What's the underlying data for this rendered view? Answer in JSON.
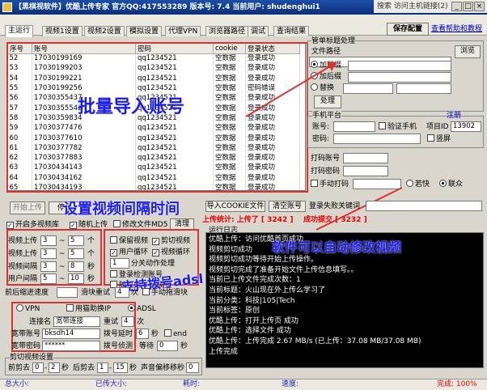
{
  "window": {
    "title": "【黑棋视软件】优酷上传专家 官方QQ:417553289 版本号: 7.4 当前用户: shudenghui1",
    "top_right_text": "搜索 访问主机链接(2)",
    "min": "_",
    "max": "□",
    "close": "×"
  },
  "tabs": [
    "主运行",
    "视频1设置",
    "视频2设置",
    "模拟设置",
    "代理VPN",
    "浏览器路径",
    "调试",
    "查询结果"
  ],
  "toolbar": {
    "save_config": "保存配置",
    "help_link": "查看帮助和教程"
  },
  "grid": {
    "columns": [
      "序号",
      "账号",
      "密码",
      "cookie",
      "登录状态"
    ],
    "rows": [
      [
        "52",
        "17030199169",
        "qq1234521",
        "空数据",
        "登录成功"
      ],
      [
        "53",
        "17030199203",
        "qq1234521",
        "空数据",
        "登录成功"
      ],
      [
        "54",
        "17030199221",
        "qq1234521",
        "空数据",
        "登录成功"
      ],
      [
        "55",
        "17030199256",
        "qq1234521",
        "空数据",
        "密码错误"
      ],
      [
        "56",
        "17030355437",
        "qq1234521",
        "空数据",
        "登录成功"
      ],
      [
        "57",
        "17030355542",
        "qq1234521",
        "空数据",
        "登录成功"
      ],
      [
        "58",
        "17030359834",
        "qq1234521",
        "空数据",
        "登录成功"
      ],
      [
        "59",
        "17030377476",
        "qq1234521",
        "空数据",
        "登录成功"
      ],
      [
        "60",
        "17030377610",
        "qq1234521",
        "空数据",
        "登录成功"
      ],
      [
        "61",
        "17030377782",
        "qq1234521",
        "空数据",
        "登录成功"
      ],
      [
        "62",
        "17030377883",
        "qq1234521",
        "空数据",
        "登录成功"
      ],
      [
        "63",
        "17030434143",
        "qq1234521",
        "空数据",
        "登录成功"
      ],
      [
        "64",
        "17030434162",
        "qq1234521",
        "空数据",
        "登录成功"
      ],
      [
        "65",
        "17030434193",
        "qq1234521",
        "空数据",
        "登录成功"
      ]
    ]
  },
  "overlays": {
    "batch_import": "批量导入账号",
    "set_interval": "设置视频间隔时间",
    "auto_modify": "软件可以自动修改视频",
    "supports_adsl": "支持拨号adsl"
  },
  "upload_panel": {
    "title": "管单标题处理",
    "file_path_label": "文件路径",
    "browse": "浏览",
    "opt_prefix": "加前缀",
    "opt_suffix": "加后缀",
    "opt_replace": "替换",
    "process": "处理"
  },
  "platform": {
    "title": "手机平台",
    "register": "注册",
    "account_label": "账号:",
    "password_label": "密码:",
    "verify_phone": "验证手机",
    "project_id_label": "项目ID",
    "project_id": "13902",
    "vertical_screen": "竖屏"
  },
  "captcha": {
    "account_label": "打码账号",
    "password_label": "打码密码",
    "manual": "手动打码",
    "ruokuai": "若快",
    "lianzhong": "联众"
  },
  "actions": {
    "start": "开始上传",
    "stop": "停止",
    "import_cookie": "导入COOKIE文件",
    "clear_accounts": "清空账号",
    "export_fail": "登录失败关键词"
  },
  "options": {
    "start_upload_folder": "开启多视频库",
    "random_upload": "随机上传",
    "modify_md5": "修改文件MD5",
    "clear": "清理",
    "upload_stats_label": "上传统计:",
    "upload_count_label": "上传了",
    "upload_count": "3242",
    "success_label": "成功提交",
    "success_count": "3232"
  },
  "video_settings": {
    "upload1_label": "视频上传",
    "upload1_a": "3",
    "upload1_b": "5",
    "upload1_unit": "个",
    "upload2_label": "视频上传",
    "upload2_a": "3",
    "upload2_b": "5",
    "upload2_unit": "个",
    "interval_label": "视频间隔",
    "interval_a": "3",
    "interval_b": "8",
    "interval_unit": "秒",
    "user_interval_label": "用户间隔",
    "user_interval_a": "5",
    "user_interval_b": "10",
    "user_interval_unit": "秒",
    "keep_video": "保留视频",
    "cut_video": "剪切视频",
    "user_loop": "用户循环",
    "video_loop": "视频循环",
    "split_minutes": "分关动作处理",
    "split_value": "1",
    "login_check": "登录检测账号",
    "random_cut": "随机剪 3 秒调整",
    "scroll_label": "前后缩进速度",
    "scroll_value": "滑块重试",
    "retry_value": "4",
    "retry_unit": "次",
    "manual_slide": "手动拖滑块"
  },
  "network": {
    "vpn": "VPN",
    "use_adsl_ip": "用猫助换IP",
    "adsl": "ADSL",
    "connect_name_label": "连接名",
    "connect_name": "宽带连接",
    "retry_label": "重试",
    "retry_value": "4",
    "retry_unit": "次",
    "broadband_account_label": "宽带账号",
    "broadband_account": "bksdh14",
    "dial_delay_label": "拨号延时",
    "dial_delay": "6",
    "dial_delay_unit": "秒",
    "end_label": "end",
    "broadband_pwd_label": "宽带密码",
    "broadband_pwd": "******",
    "dial_detect_label": "拨号侦测",
    "wait_label": "等待",
    "wait_value": "0",
    "wait_unit": "秒"
  },
  "video_cut": {
    "title": "剪切视频设置",
    "front_label": "前剪去",
    "front_a": "0",
    "front_b": "2",
    "unit": "秒",
    "back_label": "后剪去",
    "back_a": "1",
    "back_b": "15",
    "audio_label": "声音偏移移秒",
    "audio_value": "0"
  },
  "log": {
    "stats_header": "上传统计",
    "title": "运行日志",
    "lines": [
      "优酷上传：访问优酷首页成功",
      "视频剪切成功",
      "视频剪切成功等待开始上传操作。",
      "视频剪切完成了准备开始文件上传信息填写。。",
      "当前已上传文件完成次数：1",
      "当前标题：火山现在外上传么学习了",
      "当前分类：科技|105|Tech",
      "当前标签：原创",
      "优酷上传：打开上传页 成功",
      "优酷上传：选择文件 成功",
      "优酷上传：上传完成 2.67 MB/s (已上传：37.08 MB/37.08 MB)",
      "上传完成"
    ]
  },
  "status": {
    "total": "总大小:",
    "uploaded": "已传大小:",
    "elapsed": "耗时:",
    "speed": "速度:",
    "complete": "完成: 100%"
  }
}
